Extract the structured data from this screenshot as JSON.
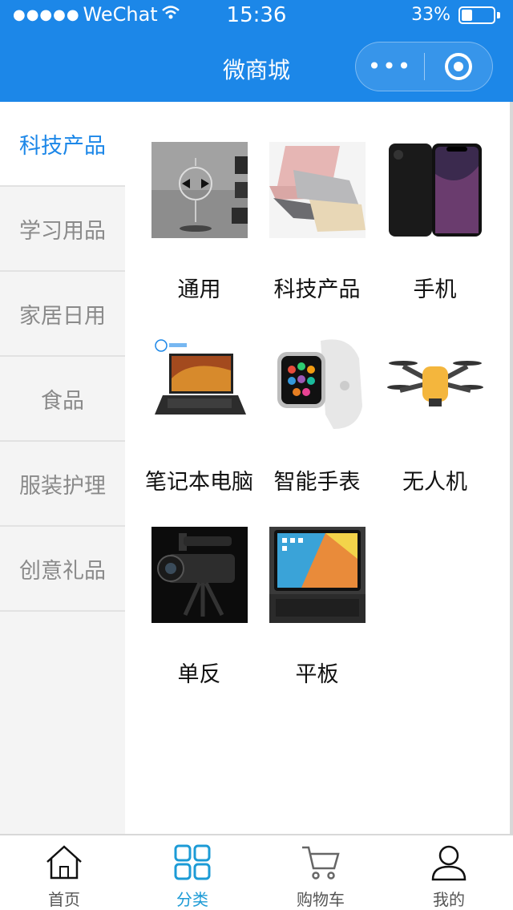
{
  "status_bar": {
    "carrier": "WeChat",
    "time": "15:36",
    "battery_text": "33%",
    "battery_level": 0.33
  },
  "nav": {
    "title": "微商城",
    "more_icon": "more-dots-icon",
    "close_icon": "target-circle-icon"
  },
  "sidebar": {
    "items": [
      {
        "label": "科技产品",
        "active": true
      },
      {
        "label": "学习用品",
        "active": false
      },
      {
        "label": "家居日用",
        "active": false
      },
      {
        "label": "食品",
        "active": false
      },
      {
        "label": "服装护理",
        "active": false
      },
      {
        "label": "创意礼品",
        "active": false
      }
    ]
  },
  "categories": [
    {
      "label": "通用",
      "icon": "radiometer-image"
    },
    {
      "label": "科技产品",
      "icon": "laptops-image"
    },
    {
      "label": "手机",
      "icon": "phone-image"
    },
    {
      "label": "笔记本电脑",
      "icon": "gaming-laptop-image"
    },
    {
      "label": "智能手表",
      "icon": "smartwatch-image"
    },
    {
      "label": "无人机",
      "icon": "drone-image"
    },
    {
      "label": "单反",
      "icon": "camera-image"
    },
    {
      "label": "平板",
      "icon": "tablet-image"
    }
  ],
  "tabs": [
    {
      "label": "首页",
      "icon": "home-icon",
      "active": false
    },
    {
      "label": "分类",
      "icon": "grid-icon",
      "active": true
    },
    {
      "label": "购物车",
      "icon": "cart-icon",
      "active": false
    },
    {
      "label": "我的",
      "icon": "user-icon",
      "active": false
    }
  ],
  "colors": {
    "brand": "#1c87e8",
    "active_tab": "#1c9bd6",
    "sidebar_bg": "#f4f4f4"
  }
}
